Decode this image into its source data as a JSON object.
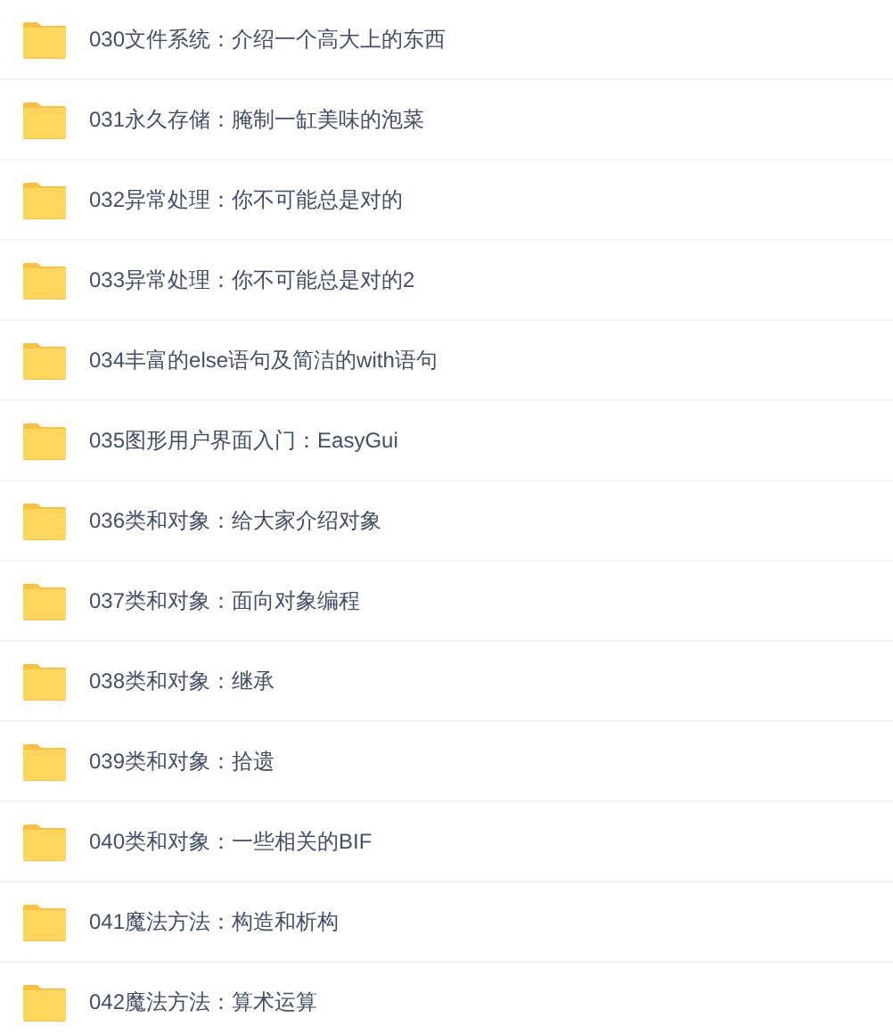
{
  "files": [
    {
      "name": "030文件系统：介绍一个高大上的东西"
    },
    {
      "name": "031永久存储：腌制一缸美味的泡菜"
    },
    {
      "name": "032异常处理：你不可能总是对的"
    },
    {
      "name": "033异常处理：你不可能总是对的2"
    },
    {
      "name": "034丰富的else语句及简洁的with语句"
    },
    {
      "name": "035图形用户界面入门：EasyGui"
    },
    {
      "name": "036类和对象：给大家介绍对象"
    },
    {
      "name": "037类和对象：面向对象编程"
    },
    {
      "name": "038类和对象：继承"
    },
    {
      "name": "039类和对象：拾遗"
    },
    {
      "name": "040类和对象：一些相关的BIF"
    },
    {
      "name": "041魔法方法：构造和析构"
    },
    {
      "name": "042魔法方法：算术运算"
    }
  ]
}
